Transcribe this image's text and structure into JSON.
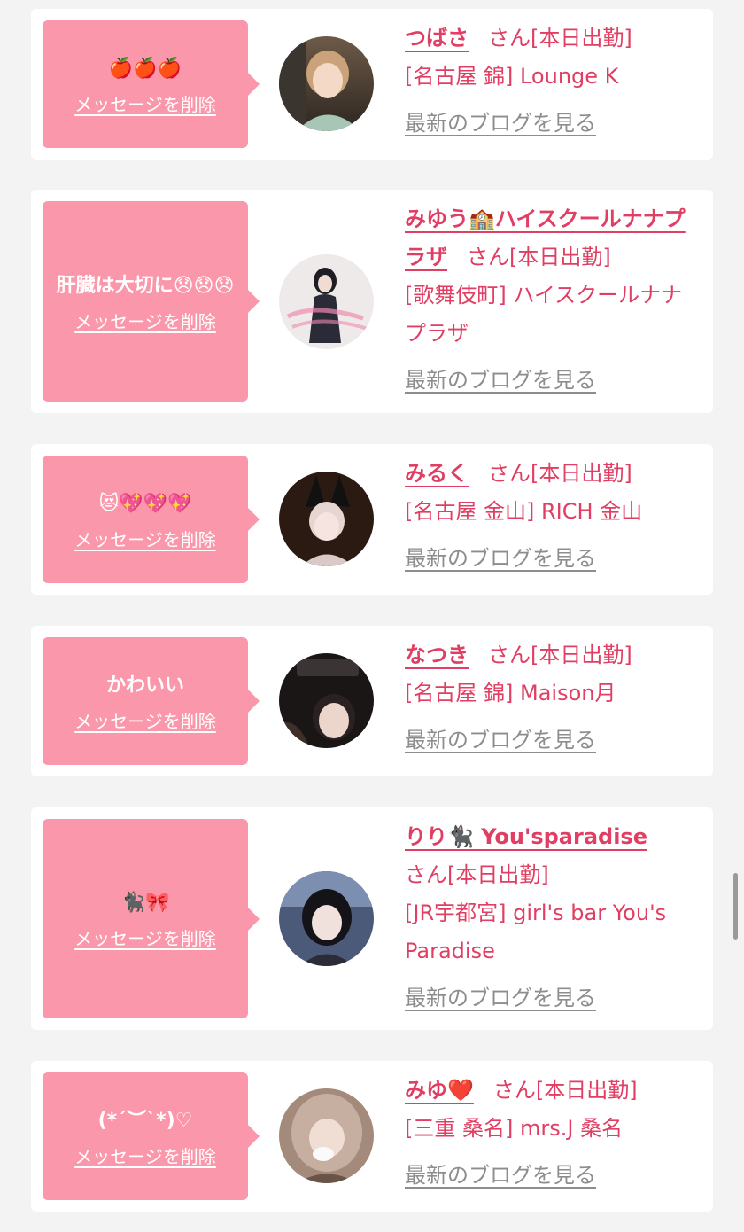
{
  "common": {
    "delete_label": "メッセージを削除",
    "blog_label": "最新のブログを見る",
    "san_label": "さん[本日出勤]"
  },
  "colors": {
    "background": "#f3f3f3",
    "bubble": "#fb97aa",
    "accent": "#e03e62",
    "muted_link": "#8d8d8d"
  },
  "cards": [
    {
      "message": "🍎🍎🍎",
      "name": "つばさ",
      "location": "[名古屋 錦] Lounge K"
    },
    {
      "message": "肝臓は大切に😞😞😞",
      "name": "みゆう🏫ハイスクールナナプラザ",
      "location": "[歌舞伎町] ハイスクールナナプラザ"
    },
    {
      "message": "😻💖💖💖",
      "name": "みるく",
      "location": "[名古屋 金山] RICH 金山"
    },
    {
      "message": "かわいい",
      "name": "なつき",
      "location": "[名古屋 錦] Maison月"
    },
    {
      "message": "🐈‍⬛🎀",
      "name": "りり🐈‍⬛ You'sparadise",
      "location": "[JR宇都宮] girl's bar You's Paradise"
    },
    {
      "message": "(*´︶`*)♡",
      "name": "みゆ❤️",
      "location": "[三重 桑名] mrs.J 桑名"
    }
  ]
}
